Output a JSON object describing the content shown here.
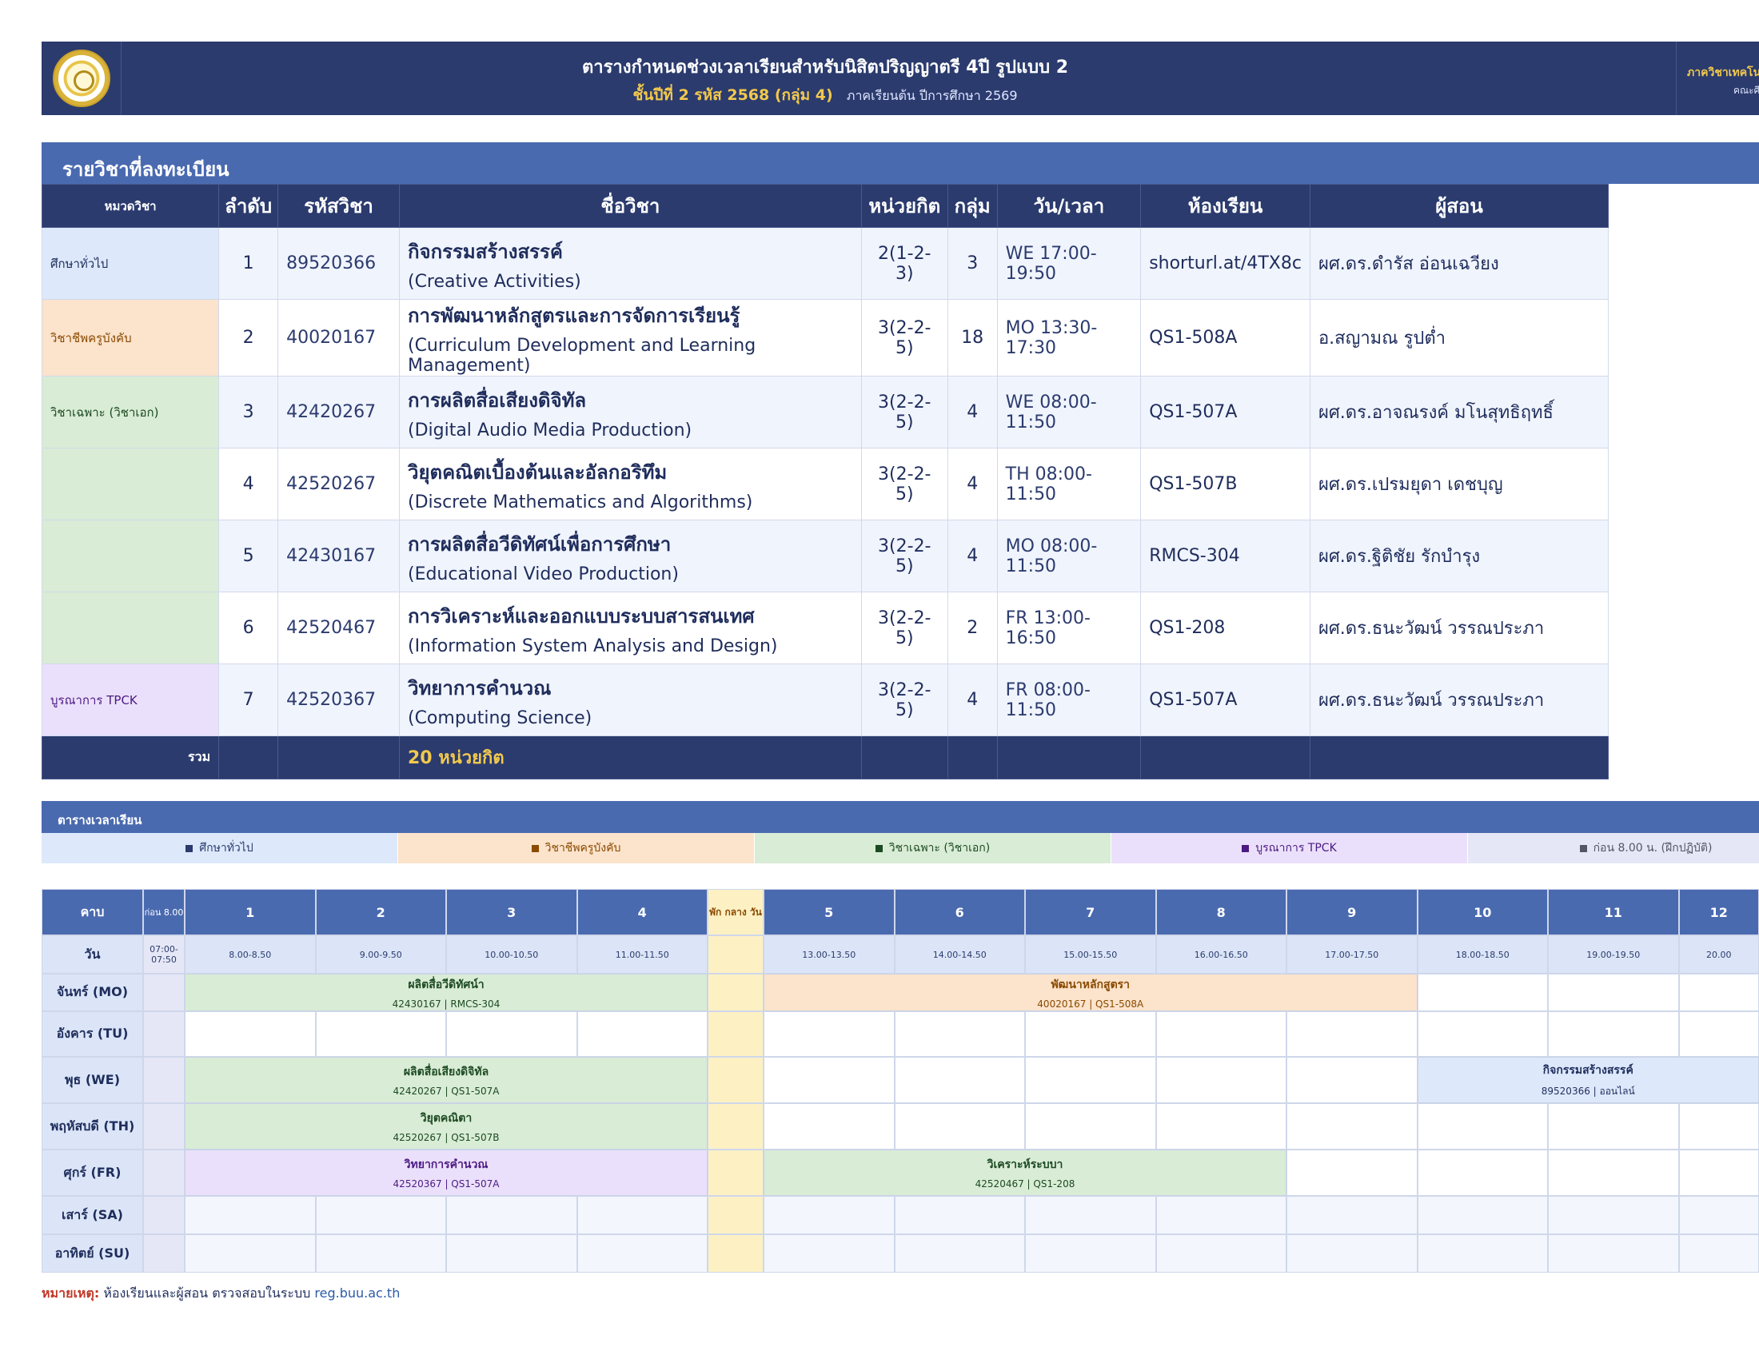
{
  "header": {
    "title": "ตารางกำหนดช่วงเวลาเรียนสำหรับนิสิตปริญญาตรี 4ปี รูปแบบ 2",
    "subtitle_main": "ชั้นปีที่ 2  รหัส 2568  (กลุ่ม 4)",
    "subtitle_term": "ภาคเรียนต้น ปีการศึกษา 2569",
    "department": "ภาควิชาเทคโนโลยีทาง",
    "faculty": "คณะศึกษาศาสต"
  },
  "courses_section": {
    "title": "รายวิชาที่ลงทะเบียน",
    "columns": [
      "หมวดวิชา",
      "ลำดับ",
      "รหัสวิชา",
      "ชื่อวิชา",
      "หน่วยกิต",
      "กลุ่ม",
      "วัน/เวลา",
      "ห้องเรียน",
      "ผู้สอน"
    ],
    "rows": [
      {
        "category": "ศึกษาทั่วไป",
        "no": "1",
        "code": "89520366",
        "name_th": "กิจกรรมสร้างสรรค์",
        "name_en": "(Creative Activities)",
        "credits": "2(1-2-3)",
        "group": "3",
        "time": "WE 17:00-19:50",
        "room": "shorturl.at/4TX8c",
        "instructor": "ผศ.ดร.ดำรัส อ่อนเฉวียง"
      },
      {
        "category": "วิชาชีพครูบังคับ",
        "no": "2",
        "code": "40020167",
        "name_th": "การพัฒนาหลักสูตรและการจัดการเรียนรู้",
        "name_en": "(Curriculum Development and Learning Management)",
        "credits": "3(2-2-5)",
        "group": "18",
        "time": "MO 13:30-17:30",
        "room": "QS1-508A",
        "instructor": "อ.สญามณ รูปต่ำ"
      },
      {
        "category": "วิชาเฉพาะ (วิชาเอก)",
        "no": "3",
        "code": "42420267",
        "name_th": "การผลิตสื่อเสียงดิจิทัล",
        "name_en": "(Digital Audio Media Production)",
        "credits": "3(2-2-5)",
        "group": "4",
        "time": "WE 08:00-11:50",
        "room": "QS1-507A",
        "instructor": "ผศ.ดร.อาจณรงค์ มโนสุทธิฤทธิ์"
      },
      {
        "category": "",
        "no": "4",
        "code": "42520267",
        "name_th": "วิยุตคณิตเบื้องต้นและอัลกอริทึม",
        "name_en": "(Discrete Mathematics and Algorithms)",
        "credits": "3(2-2-5)",
        "group": "4",
        "time": "TH 08:00-11:50",
        "room": "QS1-507B",
        "instructor": "ผศ.ดร.เปรมยุดา เดชบุญ"
      },
      {
        "category": "",
        "no": "5",
        "code": "42430167",
        "name_th": "การผลิตสื่อวีดิทัศน์เพื่อการศึกษา",
        "name_en": "(Educational Video Production)",
        "credits": "3(2-2-5)",
        "group": "4",
        "time": "MO 08:00-11:50",
        "room": "RMCS-304",
        "instructor": "ผศ.ดร.ฐิติชัย รักบำรุง"
      },
      {
        "category": "",
        "no": "6",
        "code": "42520467",
        "name_th": "การวิเคราะห์และออกแบบระบบสารสนเทศ",
        "name_en": "(Information System Analysis and Design)",
        "credits": "3(2-2-5)",
        "group": "2",
        "time": "FR 13:00-16:50",
        "room": "QS1-208",
        "instructor": "ผศ.ดร.ธนะวัฒน์ วรรณประภา"
      },
      {
        "category": "บูรณาการ TPCK",
        "no": "7",
        "code": "42520367",
        "name_th": "วิทยาการคำนวณ",
        "name_en": "(Computing Science)",
        "credits": "3(2-2-5)",
        "group": "4",
        "time": "FR 08:00-11:50",
        "room": "QS1-507A",
        "instructor": "ผศ.ดร.ธนะวัฒน์ วรรณประภา"
      }
    ],
    "total_label": "รวม",
    "total_value": "20  หน่วยกิต"
  },
  "timetable_section": {
    "title": "ตารางเวลาเรียน",
    "legend": [
      {
        "label": "ศึกษาทั่วไป",
        "color": "#2b3b6e"
      },
      {
        "label": "วิชาชีพครูบังคับ",
        "color": "#8a4a00"
      },
      {
        "label": "วิชาเฉพาะ (วิชาเอก)",
        "color": "#1c4a22"
      },
      {
        "label": "บูรณาการ TPCK",
        "color": "#4b1a83"
      },
      {
        "label": "ก่อน 8.00 น. (ฝึกปฏิบัติ)",
        "color": "#555566"
      }
    ],
    "period_header": "คาบ",
    "pre_header": "ก่อน 8.00",
    "break_header": "พัก กลาง วัน",
    "day_header": "วัน",
    "pre_time": "07:00-07:50",
    "periods": [
      {
        "n": "1",
        "t": "8.00-8.50"
      },
      {
        "n": "2",
        "t": "9.00-9.50"
      },
      {
        "n": "3",
        "t": "10.00-10.50"
      },
      {
        "n": "4",
        "t": "11.00-11.50"
      },
      {
        "n": "5",
        "t": "13.00-13.50"
      },
      {
        "n": "6",
        "t": "14.00-14.50"
      },
      {
        "n": "7",
        "t": "15.00-15.50"
      },
      {
        "n": "8",
        "t": "16.00-16.50"
      },
      {
        "n": "9",
        "t": "17.00-17.50"
      },
      {
        "n": "10",
        "t": "18.00-18.50"
      },
      {
        "n": "11",
        "t": "19.00-19.50"
      },
      {
        "n": "12",
        "t": "20.00"
      }
    ],
    "days": [
      "จันทร์ (MO)",
      "อังคาร (TU)",
      "พุธ (WE)",
      "พฤหัสบดี (TH)",
      "ศุกร์ (FR)",
      "เสาร์ (SA)",
      "อาทิตย์ (SU)"
    ],
    "blocks": [
      {
        "day": 0,
        "start": 1,
        "end": 4,
        "title": "ผลิตสื่อวีดิทัศน์า",
        "sub": "42430167 | RMCS-304",
        "cat": "ma"
      },
      {
        "day": 0,
        "start": 5,
        "end": 9,
        "title": "พัฒนาหลักสูตรา",
        "sub": "40020167 | QS1-508A",
        "cat": "pr"
      },
      {
        "day": 2,
        "start": 1,
        "end": 4,
        "title": "ผลิตสื่อเสียงดิจิทัล",
        "sub": "42420267 | QS1-507A",
        "cat": "ma"
      },
      {
        "day": 2,
        "start": 10,
        "end": 12,
        "title": "กิจกรรมสร้างสรรค์",
        "sub": "89520366 | ออนไลน์",
        "cat": "ge"
      },
      {
        "day": 3,
        "start": 1,
        "end": 4,
        "title": "วิยุตคณิตา",
        "sub": "42520267 | QS1-507B",
        "cat": "ma"
      },
      {
        "day": 4,
        "start": 1,
        "end": 4,
        "title": "วิทยาการคำนวณ",
        "sub": "42520367 | QS1-507A",
        "cat": "tp"
      },
      {
        "day": 4,
        "start": 5,
        "end": 8,
        "title": "วิเคราะห์ระบบา",
        "sub": "42520467 | QS1-208",
        "cat": "ma"
      }
    ]
  },
  "note": {
    "label": "หมายเหตุ:",
    "text": "ห้องเรียนและผู้สอน ตรวจสอบในระบบ",
    "site": "reg.buu.ac.th"
  }
}
